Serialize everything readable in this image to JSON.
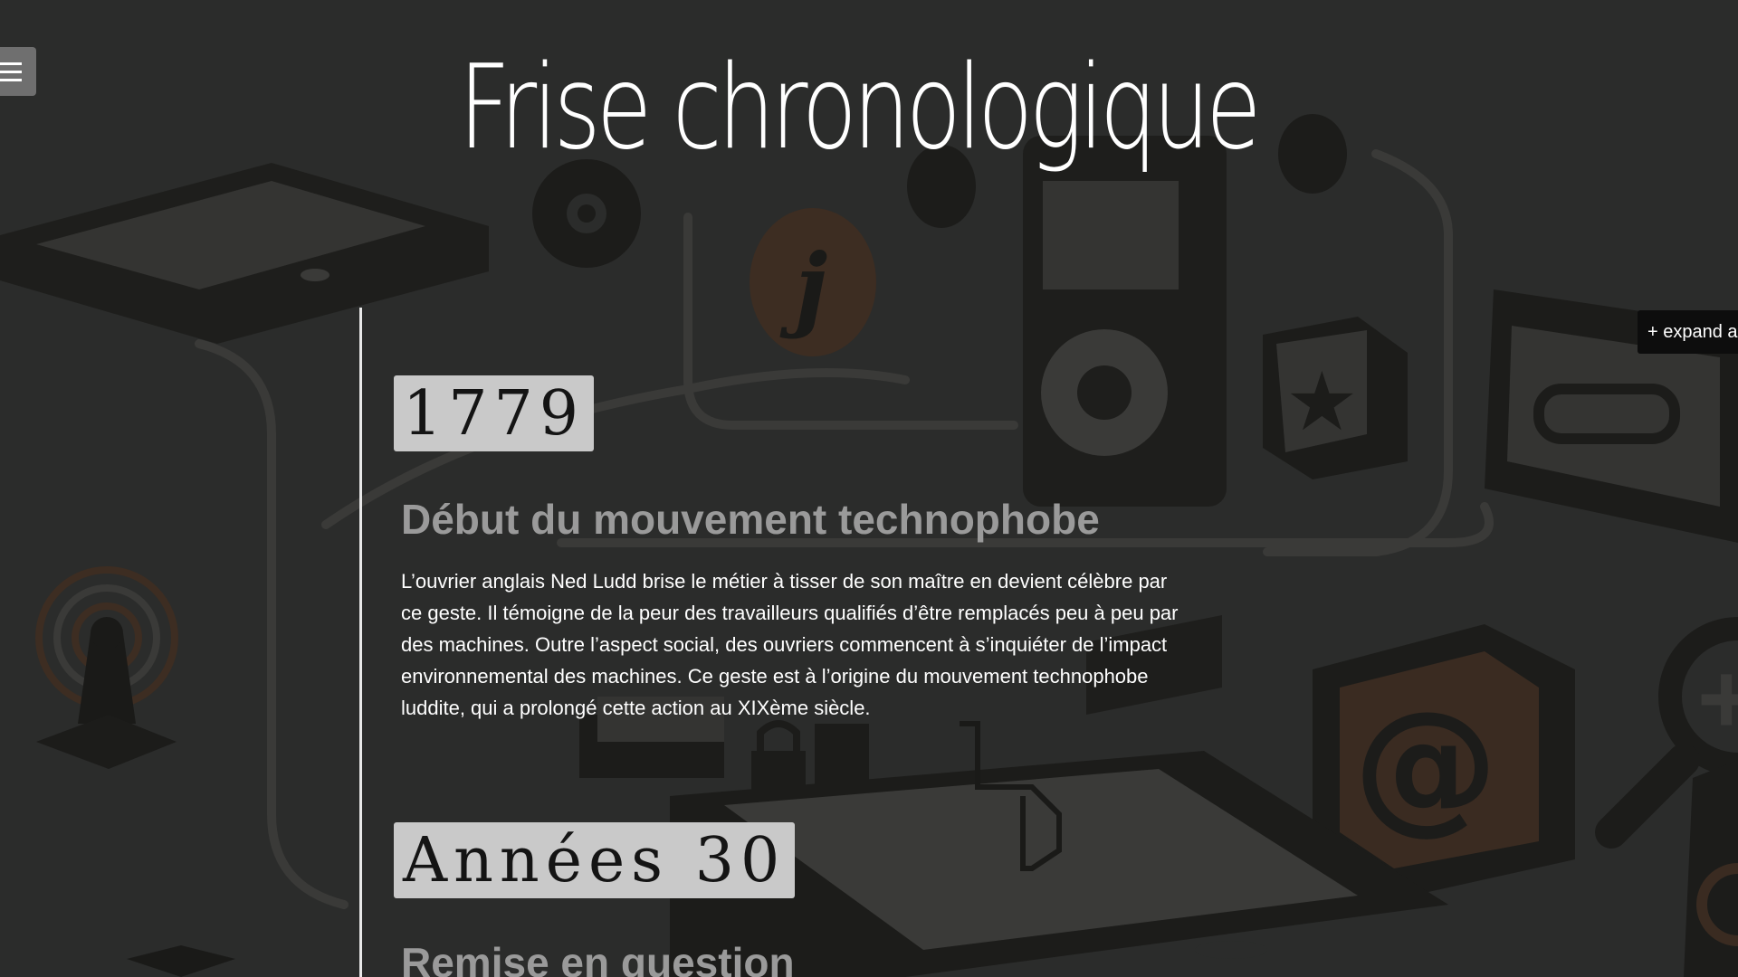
{
  "header": {
    "title": "Frise chronologique",
    "menu_icon": "hamburger-icon"
  },
  "expand_button": {
    "label": "+ expand a"
  },
  "timeline": {
    "events": [
      {
        "date": "1779",
        "title": "Début du mouvement technophobe",
        "text": "L’ouvrier anglais Ned Ludd brise le métier à tisser de son maître en devient célèbre par ce geste. Il témoigne de la peur des travailleurs qualifiés d’être remplacés peu à peu par des machines. Outre l’aspect social, des ouvriers commencent à s’inquiéter de l’impact environnemental des machines. Ce geste est à l’origine du mouvement technophobe luddite, qui a prolongé cette action au XIXème siècle."
      },
      {
        "date": "Années 30",
        "title": "Remise en question"
      }
    ]
  },
  "background": {
    "icons": [
      "tablet-icon",
      "gear-icon",
      "info-icon",
      "music-player-icon",
      "headphones-icon",
      "star-icon",
      "cassette-icon",
      "radio-tower-icon",
      "at-sign-icon",
      "magnifier-icon",
      "pointer-hand-icon",
      "lock-icon",
      "power-icon"
    ],
    "accent_color": "#4a3426"
  }
}
